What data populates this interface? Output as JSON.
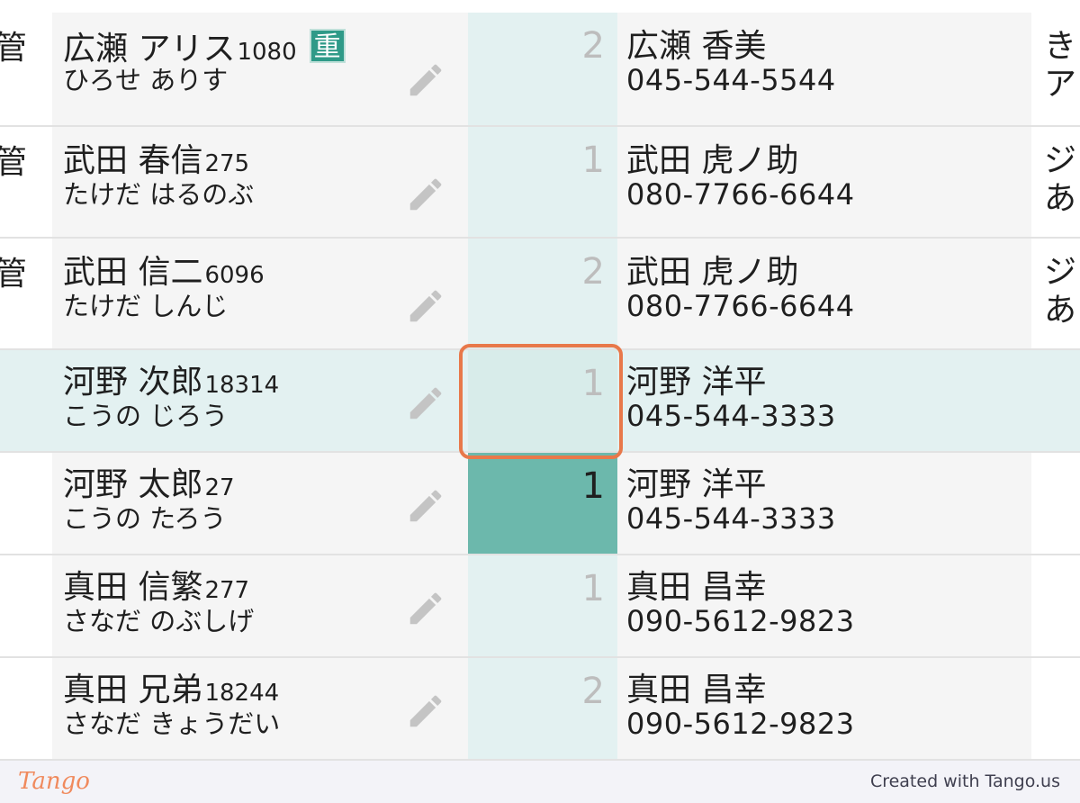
{
  "table": {
    "rows": [
      {
        "left": "管",
        "name": "広瀬 アリス",
        "num": "1080",
        "badge": "重",
        "kana": "ひろせ ありす",
        "count": "2",
        "contact_name": "広瀬 香美",
        "phone": "045-544-5544",
        "right_top": "き",
        "right_bottom": "ア"
      },
      {
        "left": "管",
        "name": "武田 春信",
        "num": "275",
        "badge": "",
        "kana": "たけだ はるのぶ",
        "count": "1",
        "contact_name": "武田 虎ノ助",
        "phone": "080-7766-6644",
        "right_top": "ジ",
        "right_bottom": "あ"
      },
      {
        "left": "管",
        "name": "武田 信二",
        "num": "6096",
        "badge": "",
        "kana": "たけだ しんじ",
        "count": "2",
        "contact_name": "武田 虎ノ助",
        "phone": "080-7766-6644",
        "right_top": "ジ",
        "right_bottom": "あ"
      },
      {
        "left": "",
        "name": "河野 次郎",
        "num": "18314",
        "badge": "",
        "kana": "こうの じろう",
        "count": "1",
        "contact_name": "河野 洋平",
        "phone": "045-544-3333",
        "right_top": "",
        "right_bottom": ""
      },
      {
        "left": "",
        "name": "河野 太郎",
        "num": "27",
        "badge": "",
        "kana": "こうの たろう",
        "count": "1",
        "contact_name": "河野 洋平",
        "phone": "045-544-3333",
        "right_top": "",
        "right_bottom": ""
      },
      {
        "left": "",
        "name": "真田 信繁",
        "num": "277",
        "badge": "",
        "kana": "さなだ のぶしげ",
        "count": "1",
        "contact_name": "真田 昌幸",
        "phone": "090-5612-9823",
        "right_top": "",
        "right_bottom": ""
      },
      {
        "left": "",
        "name": "真田 兄弟",
        "num": "18244",
        "badge": "",
        "kana": "さなだ きょうだい",
        "count": "2",
        "contact_name": "真田 昌幸",
        "phone": "090-5612-9823",
        "right_top": "",
        "right_bottom": ""
      }
    ]
  },
  "icons": {
    "edit": "pencil-icon"
  },
  "colors": {
    "accent": "#6cb8ac",
    "highlight": "#e3f1f1",
    "badge": "#2f9a88",
    "focus": "#e8784a"
  },
  "footer": {
    "logo": "Tango",
    "credit": "Created with Tango.us"
  }
}
